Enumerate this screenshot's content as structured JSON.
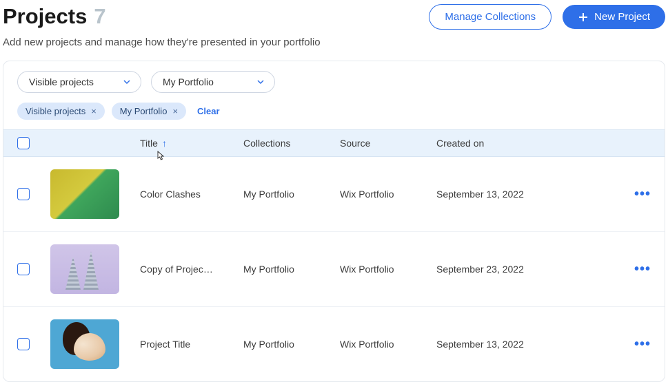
{
  "header": {
    "title": "Projects",
    "count": "7",
    "manage_collections_label": "Manage Collections",
    "new_project_label": "New Project"
  },
  "subtitle": "Add new projects and manage how they're presented in your portfolio",
  "filters": {
    "visibility_select": "Visible projects",
    "collection_select": "My Portfolio"
  },
  "chips": [
    {
      "label": "Visible projects"
    },
    {
      "label": "My Portfolio"
    }
  ],
  "clear_label": "Clear",
  "columns": {
    "title": "Title",
    "collections": "Collections",
    "source": "Source",
    "created": "Created on"
  },
  "rows": [
    {
      "title": "Color Clashes",
      "collections": "My Portfolio",
      "source": "Wix Portfolio",
      "created": "September 13, 2022"
    },
    {
      "title": "Copy of Projec…",
      "collections": "My Portfolio",
      "source": "Wix Portfolio",
      "created": "September 23, 2022"
    },
    {
      "title": "Project Title",
      "collections": "My Portfolio",
      "source": "Wix Portfolio",
      "created": "September 13, 2022"
    }
  ]
}
